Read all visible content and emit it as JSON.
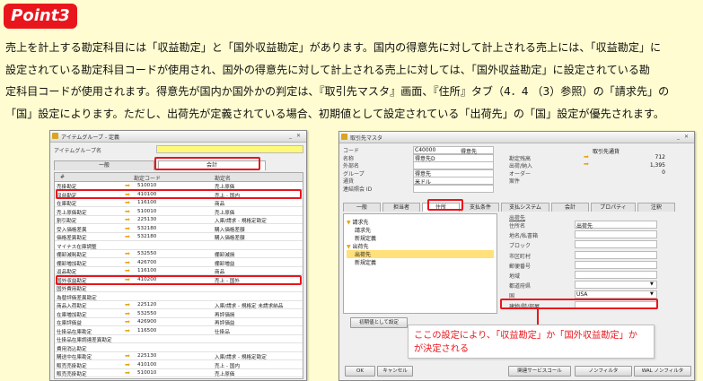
{
  "badge": "Point3",
  "description": [
    "売上を計上する勘定科目には「収益勘定」と「国外収益勘定」があります。国内の得意先に対して計上される売上には、「収益勘定」に",
    "設定されている勘定科目コードが使用され、国外の得意先に対して計上される売上に対しては、「国外収益勘定」に設定されている勘",
    "定科目コードが使用されます。得意先が国内か国外かの判定は、『取引先マスタ』画面、『住所』タブ（4．4 （3）参照）の「請求先」の",
    "「国」設定によります。ただし、出荷先が定義されている場合、初期値として設定されている「出荷先」の「国」設定が優先されます。"
  ],
  "left_window": {
    "title": "アイテムグループ - 定義",
    "group_name_label": "アイテムグループ名",
    "tabs": [
      "一般",
      "会計"
    ],
    "columns": [
      "#",
      "勘定コード",
      "勘定名"
    ],
    "rows": [
      {
        "name": "売掛勘定",
        "code": "510010",
        "account": "売上原価"
      },
      {
        "name": "収益勘定",
        "code": "410100",
        "account": "売上 - 国内"
      },
      {
        "name": "在庫勘定",
        "code": "116100",
        "account": "商品"
      },
      {
        "name": "売上原価勘定",
        "code": "510010",
        "account": "売上原価"
      },
      {
        "name": "割引勘定",
        "code": "225130",
        "account": "入庫/請求 - 規格定勘定"
      },
      {
        "name": "受入価格差異",
        "code": "532180",
        "account": "購入価格差額"
      },
      {
        "name": "価格差異勘定",
        "code": "532180",
        "account": "購入価格差額"
      },
      {
        "name": "マイナス在庫調整",
        "code": "",
        "account": ""
      },
      {
        "name": "棚卸減耗勘定",
        "code": "532550",
        "account": "棚卸減損"
      },
      {
        "name": "棚卸増加勘定",
        "code": "426700",
        "account": "棚卸増益"
      },
      {
        "name": "返品勘定",
        "code": "116100",
        "account": "商品"
      },
      {
        "name": "国外収益勘定",
        "code": "410200",
        "account": "売上 - 国外"
      },
      {
        "name": "国外費用勘定",
        "code": "",
        "account": ""
      },
      {
        "name": "為替評価差異勘定",
        "code": "",
        "account": ""
      },
      {
        "name": "商品入荷勘定",
        "code": "225120",
        "account": "入庫/請求 - 規格定 未請求納品"
      },
      {
        "name": "在庫増加勘定",
        "code": "532550",
        "account": "再評価損"
      },
      {
        "name": "在庫評価益",
        "code": "426900",
        "account": "再評価益"
      },
      {
        "name": "仕掛品在庫勘定",
        "code": "116500",
        "account": "仕掛品"
      },
      {
        "name": "仕掛品在庫調達差異勘定",
        "code": "",
        "account": ""
      },
      {
        "name": "費用消込勘定",
        "code": "",
        "account": ""
      },
      {
        "name": "購送中在庫勘定",
        "code": "225130",
        "account": "入庫/請求 - 規格定勘定"
      },
      {
        "name": "販売売掛勘定",
        "code": "410100",
        "account": "売上 - 国内"
      },
      {
        "name": "販売売掛勘定",
        "code": "510010",
        "account": "売上原価"
      }
    ]
  },
  "right_window": {
    "title": "取引先マスタ",
    "fields": [
      {
        "label": "コード",
        "value": "C40000",
        "extra": "得意先"
      },
      {
        "label": "名称",
        "value": "得意先D"
      },
      {
        "label": "外部名",
        "value": ""
      },
      {
        "label": "グループ",
        "value": "得意先"
      },
      {
        "label": "通貨",
        "value": "米ドル"
      },
      {
        "label": "連結照会 ID",
        "value": ""
      }
    ],
    "right_fields": [
      {
        "label": "",
        "value": "取引先通貨"
      },
      {
        "label": "勘定残高",
        "value": "712"
      },
      {
        "label": "出荷/納入",
        "value": "1,395"
      },
      {
        "label": "オーダー",
        "value": "0"
      },
      {
        "label": "案件",
        "value": ""
      }
    ],
    "tabs": [
      "一般",
      "担当者",
      "住所",
      "支払条件",
      "支払システム",
      "会計",
      "プロパティ",
      "注釈"
    ],
    "tree": {
      "bill_header": "請求先",
      "bill_items": [
        "請求先",
        "新規定義"
      ],
      "ship_header": "出荷先",
      "ship_items": [
        "出荷先",
        "新規定義"
      ]
    },
    "address_header": "出荷先",
    "address_fields": [
      {
        "label": "住所名",
        "value": "出荷先"
      },
      {
        "label": "地名/私書箱",
        "value": ""
      },
      {
        "label": "ブロック",
        "value": ""
      },
      {
        "label": "市区町村",
        "value": ""
      },
      {
        "label": "郵便番号",
        "value": ""
      },
      {
        "label": "地域",
        "value": ""
      },
      {
        "label": "都道府県",
        "value": ""
      },
      {
        "label": "国",
        "value": "USA"
      },
      {
        "label": "建物/階/部屋",
        "value": ""
      }
    ],
    "set_default_button": "初期値として設定",
    "ok_button": "OK",
    "cancel_button": "キャンセル",
    "related_service_button": "関連サービスコール",
    "nav_button_1": "ノンフィルタ",
    "nav_button_2": "WAL ノンフィルタ"
  },
  "callout": [
    "ここの設定により、「収益勘定」か「国外収益勘定」か",
    "が決定される"
  ]
}
